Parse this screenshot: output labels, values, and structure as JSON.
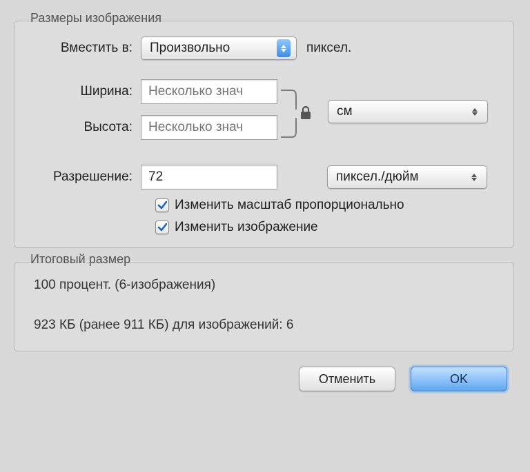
{
  "groups": {
    "dimensions_title": "Размеры изображения",
    "result_title": "Итоговый размер"
  },
  "fit": {
    "label": "Вместить в:",
    "value": "Произвольно",
    "unit_after": "пиксел."
  },
  "width": {
    "label": "Ширина:",
    "placeholder": "Несколько знач"
  },
  "height": {
    "label": "Высота:",
    "placeholder": "Несколько знач"
  },
  "wh_unit": {
    "value": "см"
  },
  "resolution": {
    "label": "Разрешение:",
    "value": "72",
    "unit": "пиксел./дюйм"
  },
  "checks": {
    "scale_proportional": "Изменить масштаб пропорционально",
    "resample": "Изменить изображение"
  },
  "result": {
    "line1": "100 процент. (6-изображения)",
    "line2": "923 КБ (ранее 911 КБ) для изображений: 6"
  },
  "buttons": {
    "cancel": "Отменить",
    "ok": "OK"
  }
}
